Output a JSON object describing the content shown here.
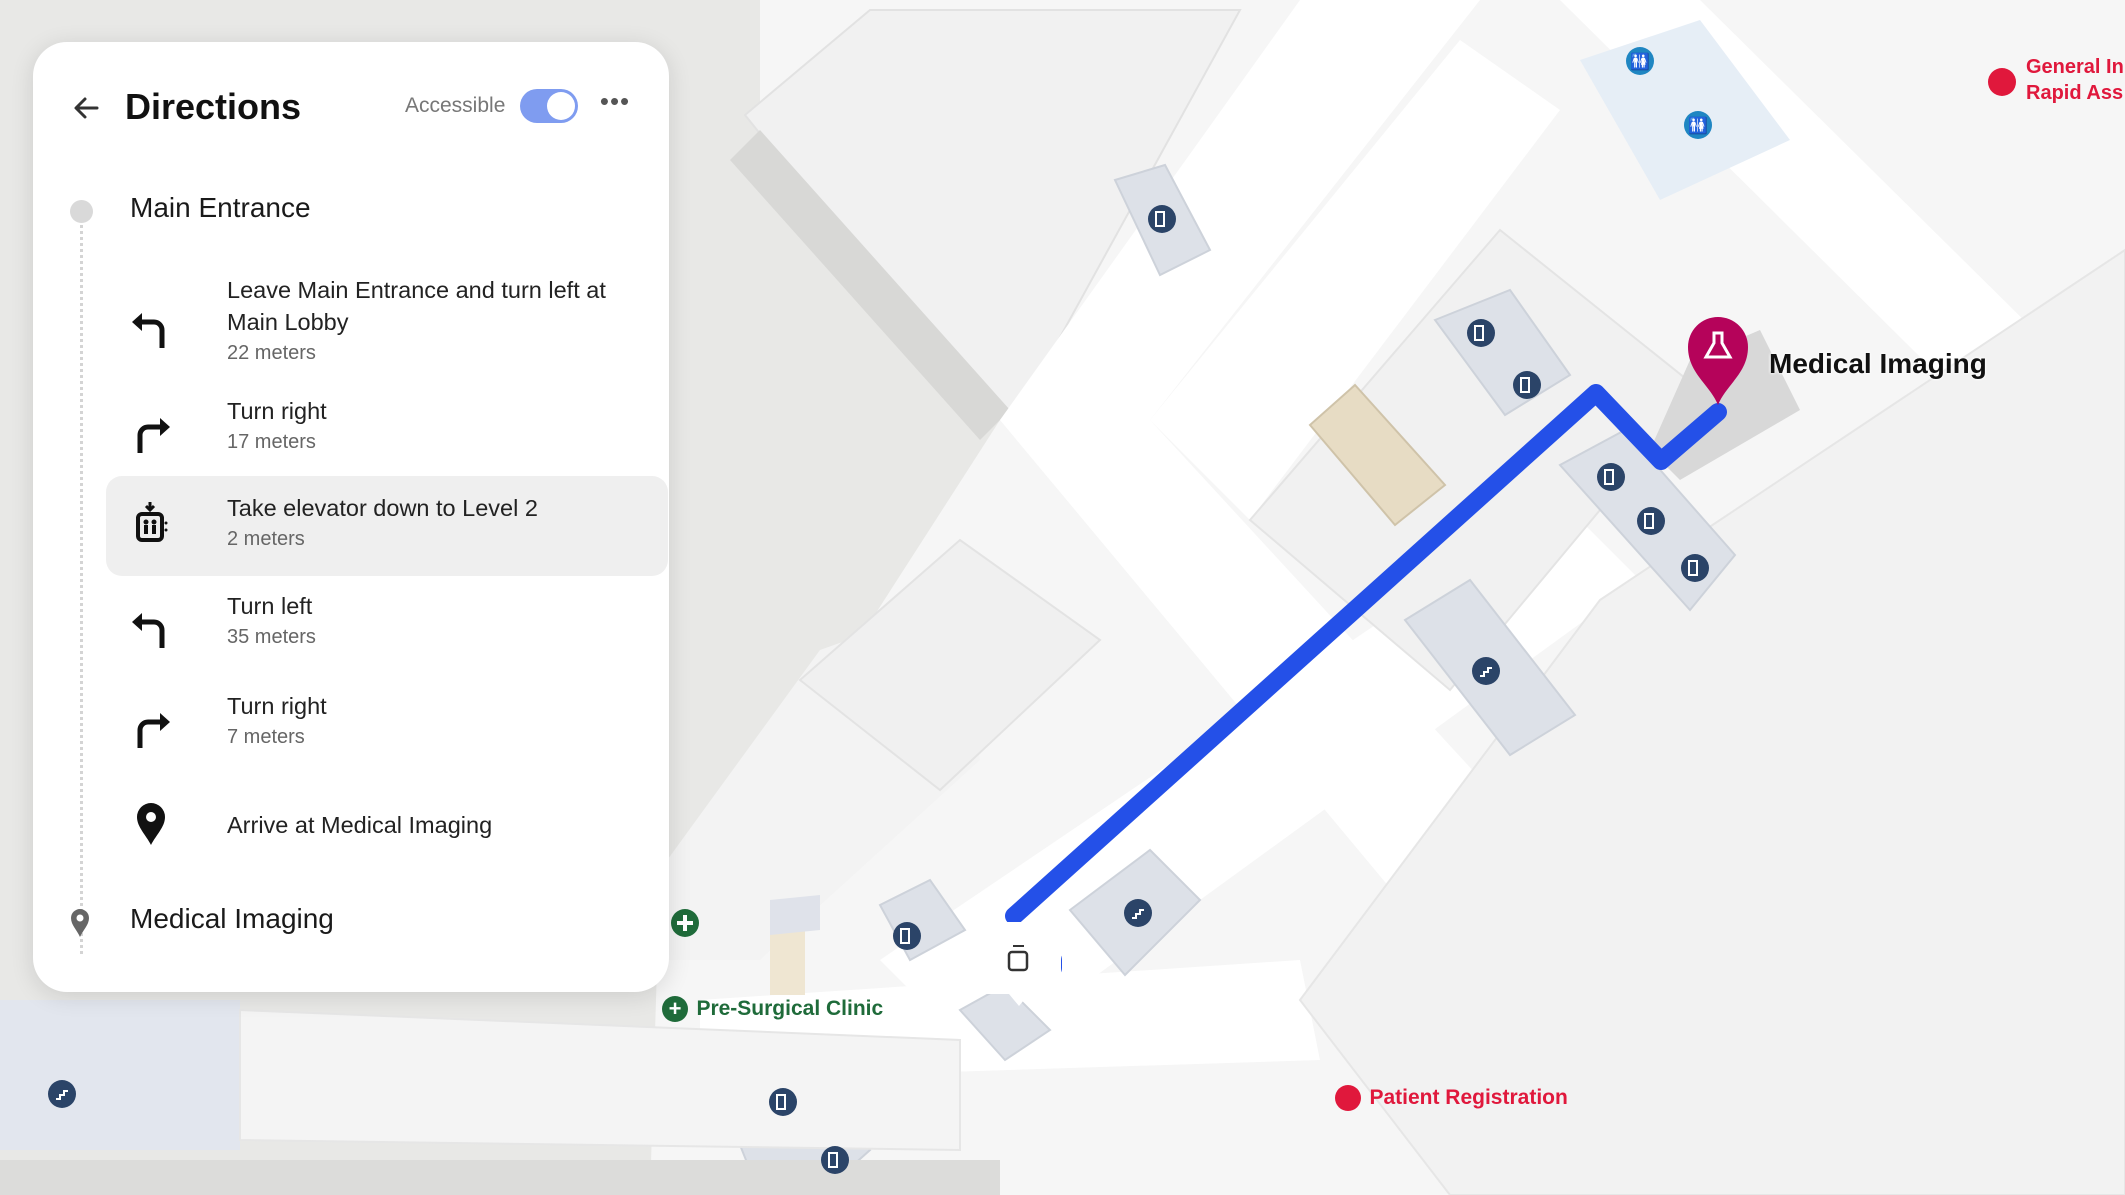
{
  "panel": {
    "title": "Directions",
    "back_icon": "arrow-left-icon",
    "accessible_label": "Accessible",
    "accessible_on": true,
    "more_icon": "more-horizontal-icon",
    "origin": "Main Entrance",
    "destination": "Medical Imaging",
    "steps": [
      {
        "icon": "turn-left-icon",
        "instruction": "Leave Main Entrance and turn left at Main Lobby",
        "distance": "22 meters",
        "active": false
      },
      {
        "icon": "turn-right-icon",
        "instruction": "Turn right",
        "distance": "17 meters",
        "active": false
      },
      {
        "icon": "elevator-down-icon",
        "instruction": "Take elevator down to Level 2",
        "distance": "2 meters",
        "active": true
      },
      {
        "icon": "turn-left-icon",
        "instruction": "Turn left",
        "distance": "35 meters",
        "active": false
      },
      {
        "icon": "turn-right-icon",
        "instruction": "Turn right",
        "distance": "7 meters",
        "active": false
      },
      {
        "icon": "location-pin-icon",
        "instruction": "Arrive at Medical Imaging",
        "distance": "",
        "active": false
      }
    ]
  },
  "map": {
    "route_color": "#2450e8",
    "destination_pin_color": "#b5035a",
    "labels": {
      "destination": "Medical Imaging",
      "pre_surgical": "Pre-Surgical Clinic",
      "patient_registration": "Patient Registration",
      "general_line1": "General In",
      "general_line2": "Rapid Ass"
    },
    "colors": {
      "clinic_green": "#1f6b3a",
      "emergency_red": "#e0183c",
      "restroom_blue": "#1f86c2",
      "facility_navy": "#2b4468"
    }
  }
}
